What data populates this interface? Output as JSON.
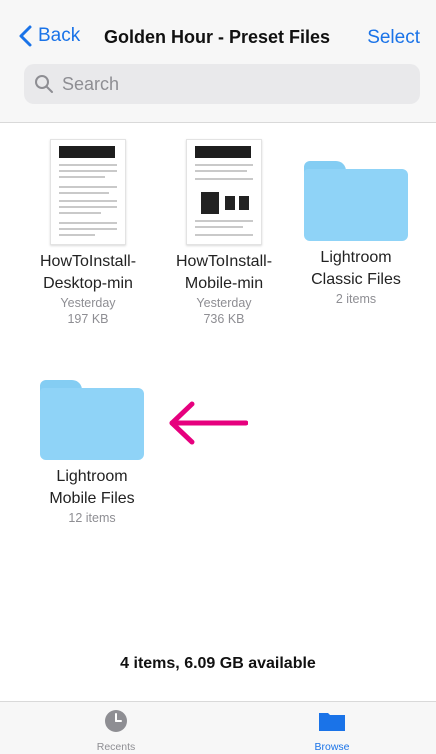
{
  "nav": {
    "back_label": "Back",
    "title": "Golden Hour - Preset Files",
    "select_label": "Select"
  },
  "search": {
    "placeholder": "Search"
  },
  "items": [
    {
      "name_line1": "HowToInstall-",
      "name_line2": "Desktop-min",
      "meta1": "Yesterday",
      "meta2": "197 KB",
      "kind": "document"
    },
    {
      "name_line1": "HowToInstall-",
      "name_line2": "Mobile-min",
      "meta1": "Yesterday",
      "meta2": "736 KB",
      "kind": "document"
    },
    {
      "name_line1": "Lightroom",
      "name_line2": "Classic Files",
      "meta1": "2 items",
      "kind": "folder"
    },
    {
      "name_line1": "Lightroom",
      "name_line2": "Mobile Files",
      "meta1": "12 items",
      "kind": "folder"
    }
  ],
  "status": "4 items, 6.09 GB available",
  "tabbar": {
    "recents_label": "Recents",
    "browse_label": "Browse"
  },
  "colors": {
    "accent": "#1a73e8",
    "folder": "#8fd3f7",
    "arrow": "#e6007e",
    "inactive": "#8e8e93"
  }
}
